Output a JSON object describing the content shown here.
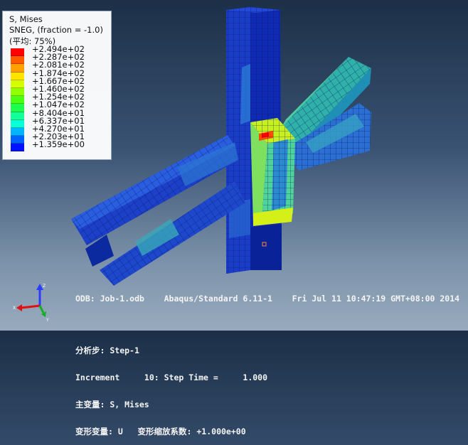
{
  "legend": {
    "title": "S, Mises",
    "subtitle": "SNEG, (fraction = -1.0)",
    "avg": "(平均: 75%)",
    "colors": [
      "#ff0000",
      "#ff5a00",
      "#ff9f00",
      "#ffe400",
      "#d6ff00",
      "#91ff00",
      "#4cff12",
      "#1cff4d",
      "#12ff99",
      "#09ffd8",
      "#00b4ff",
      "#0062ff",
      "#0010ff"
    ],
    "values": [
      "+2.494e+02",
      "+2.287e+02",
      "+2.081e+02",
      "+1.874e+02",
      "+1.667e+02",
      "+1.460e+02",
      "+1.254e+02",
      "+1.047e+02",
      "+8.404e+01",
      "+6.337e+01",
      "+4.270e+01",
      "+2.203e+01",
      "+1.359e+00"
    ]
  },
  "info": {
    "odb": "ODB: Job-1.odb    Abaqus/Standard 6.11-1    Fri Jul 11 10:47:19 GMT+08:00 2014",
    "step": "分析步: Step-1",
    "increment": "Increment     10: Step Time =     1.000",
    "primary": "主变量: S, Mises",
    "deformed": "变形变量: U   变形缩放系数: +1.000e+00"
  },
  "triad": {
    "x": "X",
    "y": "Y",
    "z": "Z"
  }
}
